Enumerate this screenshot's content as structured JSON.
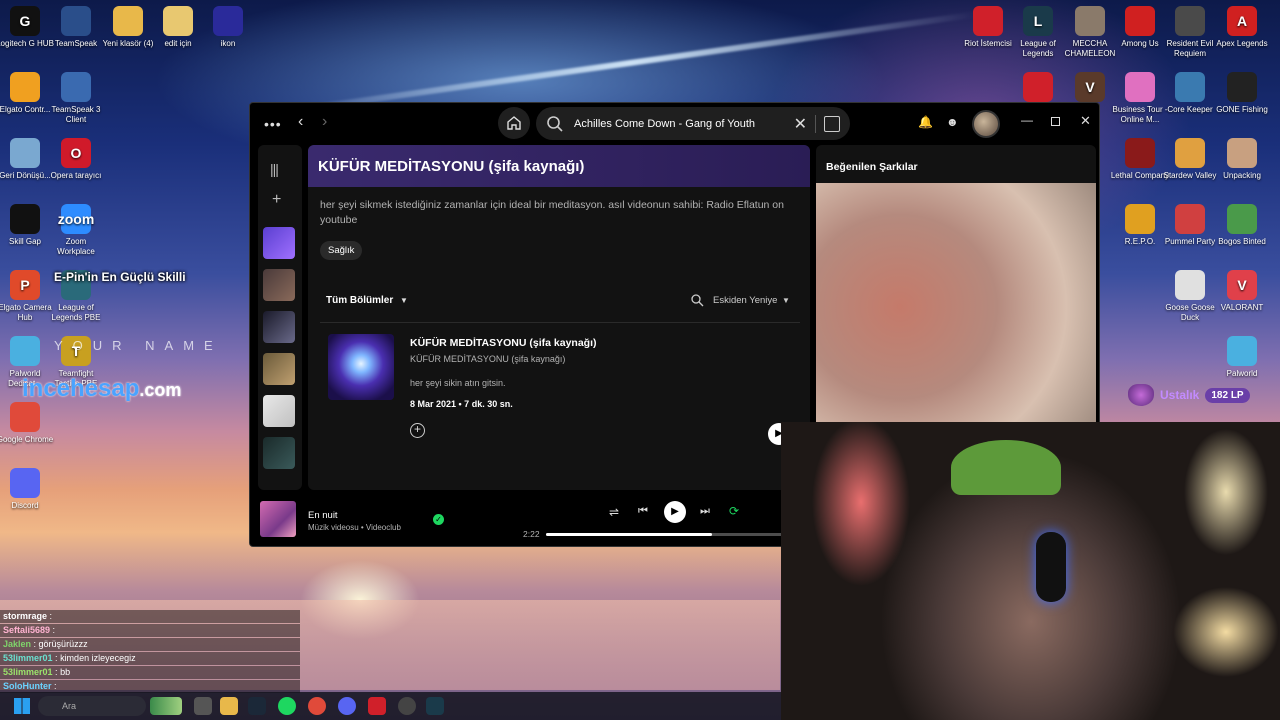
{
  "desktop": {
    "icons_left": [
      {
        "label": "Logitech G HUB",
        "glyph": "G",
        "color": "#111"
      },
      {
        "label": "TeamSpeak",
        "glyph": "",
        "color": "#2a4e8a"
      },
      {
        "label": "Yeni klasör (4)",
        "glyph": "",
        "color": "#e8b84a"
      },
      {
        "label": "edit için",
        "glyph": "",
        "color": "#e8c870"
      },
      {
        "label": "ikon",
        "glyph": "",
        "color": "#2a2a9a"
      },
      {
        "label": "Elgato Contr...",
        "glyph": "",
        "color": "#f0a020"
      },
      {
        "label": "TeamSpeak 3 Client",
        "glyph": "",
        "color": "#3a6ab0"
      },
      {
        "label": "Geri Dönüşü...",
        "glyph": "",
        "color": "#7aa8d0"
      },
      {
        "label": "Opera tarayıcı",
        "glyph": "O",
        "color": "#d01a2a"
      },
      {
        "label": "Skill Gap",
        "glyph": "",
        "color": "#111"
      },
      {
        "label": "Zoom Workplace",
        "glyph": "zoom",
        "color": "#2d8cff"
      },
      {
        "label": "Elgato Camera Hub",
        "glyph": "P",
        "color": "#e04a2a"
      },
      {
        "label": "League of Legends PBE",
        "glyph": "",
        "color": "#2a6a7a"
      },
      {
        "label": "Palworld Dedicat...",
        "glyph": "",
        "color": "#4ab0e0"
      },
      {
        "label": "Teamfight Tactics PBE",
        "glyph": "T",
        "color": "#c8a020"
      },
      {
        "label": "Google Chrome",
        "glyph": "",
        "color": "#e04a3a"
      },
      {
        "label": "Discord",
        "glyph": "",
        "color": "#5865f2"
      }
    ],
    "icons_right": [
      {
        "label": "Riot İstemcisi",
        "glyph": "",
        "color": "#d0202a"
      },
      {
        "label": "League of Legends",
        "glyph": "L",
        "color": "#1a3a4a"
      },
      {
        "label": "MECCHA CHAMELEON",
        "glyph": "",
        "color": "#8a7a6a"
      },
      {
        "label": "Among Us",
        "glyph": "",
        "color": "#d02020"
      },
      {
        "label": "Resident Evil Requiem",
        "glyph": "",
        "color": "#4a4a4a"
      },
      {
        "label": "Apex Legends",
        "glyph": "A",
        "color": "#d02020"
      },
      {
        "label": "",
        "glyph": "",
        "color": "#d0202a"
      },
      {
        "label": "",
        "glyph": "V",
        "color": "#5a3a2a"
      },
      {
        "label": "Business Tour - Online M...",
        "glyph": "",
        "color": "#e070c0"
      },
      {
        "label": "Core Keeper",
        "glyph": "",
        "color": "#3a7ab0"
      },
      {
        "label": "GONE Fishing",
        "glyph": "",
        "color": "#222"
      },
      {
        "label": "Lethal Company",
        "glyph": "",
        "color": "#8a1a1a"
      },
      {
        "label": "Stardew Valley",
        "glyph": "",
        "color": "#e0a040"
      },
      {
        "label": "Unpacking",
        "glyph": "",
        "color": "#c8a080"
      },
      {
        "label": "R.E.P.O.",
        "glyph": "",
        "color": "#e0a020"
      },
      {
        "label": "Pummel Party",
        "glyph": "",
        "color": "#d04040"
      },
      {
        "label": "Bogos Binted",
        "glyph": "",
        "color": "#4a9a4a"
      },
      {
        "label": "Goose Goose Duck",
        "glyph": "",
        "color": "#e0e0e0"
      },
      {
        "label": "VALORANT",
        "glyph": "V",
        "color": "#e0404a"
      },
      {
        "label": "Palworld",
        "glyph": "",
        "color": "#4ab0e0"
      }
    ]
  },
  "overlay": {
    "title": "E-Pin'in En Güçlü Skilli",
    "name": "YOUR NAME",
    "brand_main": "incehesap",
    "brand_tld": ".com",
    "rank_label": "Ustalık",
    "rank_lp": "182 LP"
  },
  "spotify": {
    "search_text": "Achilles Come Down - Gang of Youth",
    "show_title": "KÜFÜR MEDİTASYONU (şifa kaynağı)",
    "show_description": "her şeyi sikmek istediğiniz zamanlar için ideal bir meditasyon. asıl videonun sahibi: Radio Eflatun on youtube",
    "tag": "Sağlık",
    "filter_label": "Tüm Bölümler",
    "sort_label": "Eskiden Yeniye",
    "episode": {
      "title": "KÜFÜR MEDİTASYONU (şifa kaynağı)",
      "show": "KÜFÜR MEDİTASYONU (şifa kaynağı)",
      "description": "her şeyi sikin atın gitsin.",
      "meta": "8 Mar 2021 • 7 dk. 30 sn."
    },
    "right_panel_title": "Beğenilen Şarkılar",
    "player": {
      "track": "En nuit",
      "subtitle": "Müzik videosu • Videoclub",
      "elapsed": "2:22",
      "progress": 0.69
    }
  },
  "chat": [
    {
      "user": "stormrage",
      "text": ""
    },
    {
      "user": "Seftali5689",
      "text": ""
    },
    {
      "user": "Jaklen",
      "text": "görüşürüzzz"
    },
    {
      "user": "53limmer01",
      "text": "kimden izleyecegiz"
    },
    {
      "user": "53limmer01",
      "text": "bb"
    },
    {
      "user": "SoloHunter",
      "text": ""
    }
  ],
  "taskbar": {
    "search_placeholder": "Ara"
  }
}
